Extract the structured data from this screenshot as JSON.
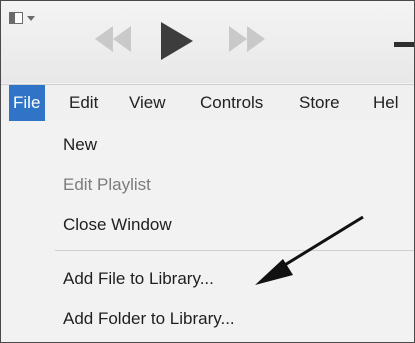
{
  "menubar": {
    "items": [
      {
        "label": "File",
        "active": true
      },
      {
        "label": "Edit"
      },
      {
        "label": "View"
      },
      {
        "label": "Controls"
      },
      {
        "label": "Store"
      },
      {
        "label": "Hel"
      }
    ]
  },
  "file_menu": {
    "items": [
      {
        "label": "New",
        "enabled": true
      },
      {
        "label": "Edit Playlist",
        "enabled": false
      },
      {
        "label": "Close Window",
        "enabled": true
      },
      {
        "label": "Add File to Library...",
        "enabled": true
      },
      {
        "label": "Add Folder to Library...",
        "enabled": true
      }
    ]
  },
  "icons": {
    "layout": "window-layout-icon",
    "rewind": "rewind-icon",
    "play": "play-icon",
    "fast_forward": "fast-forward-icon",
    "annotation": "arrow-pointer-icon"
  },
  "colors": {
    "menu_highlight": "#2f74c6",
    "disabled_text": "#7c7c7c"
  }
}
